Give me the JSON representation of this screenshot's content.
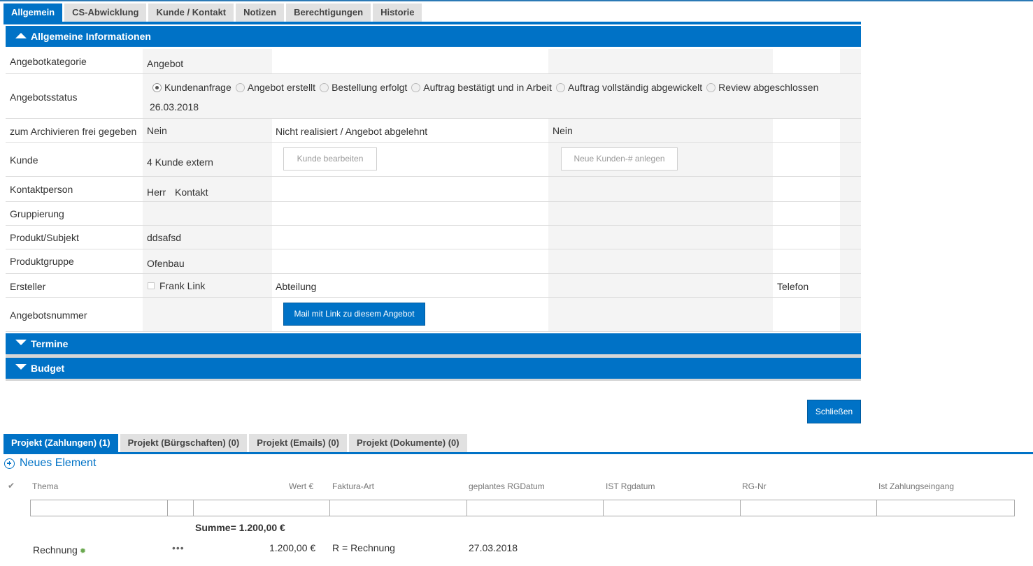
{
  "tabs": [
    "Allgemein",
    "CS-Abwicklung",
    "Kunde / Kontakt",
    "Notizen",
    "Berechtigungen",
    "Historie"
  ],
  "sections": {
    "general": "Allgemeine Informationen",
    "termine": "Termine",
    "budget": "Budget"
  },
  "form": {
    "angebotkategorie": {
      "label": "Angebotkategorie",
      "value": "Angebot"
    },
    "angebotsstatus": {
      "label": "Angebotsstatus",
      "options": [
        "Kundenanfrage",
        "Angebot erstellt",
        "Bestellung erfolgt",
        "Auftrag bestätigt und in Arbeit",
        "Auftrag vollständig abgewickelt",
        "Review abgeschlossen"
      ],
      "selected": "Kundenanfrage",
      "date": "26.03.2018"
    },
    "archiv": {
      "label": "zum Archivieren frei gegeben",
      "value": "Nein",
      "label2": "Nicht realisiert / Angebot abgelehnt",
      "value2": "Nein"
    },
    "kunde": {
      "label": "Kunde",
      "value": "4 Kunde extern",
      "edit_button": "Kunde bearbeiten",
      "new_button": "Neue Kunden-# anlegen"
    },
    "kontaktperson": {
      "label": "Kontaktperson",
      "anrede": "Herr",
      "name": "Kontakt"
    },
    "gruppierung": {
      "label": "Gruppierung"
    },
    "produkt": {
      "label": "Produkt/Subjekt",
      "value": "ddsafsd"
    },
    "produktgruppe": {
      "label": "Produktgruppe",
      "value": "Ofenbau"
    },
    "ersteller": {
      "label": "Ersteller",
      "value": "Frank Link",
      "abteilung_label": "Abteilung",
      "telefon_label": "Telefon"
    },
    "angebotsnummer": {
      "label": "Angebotsnummer",
      "mail_button": "Mail mit Link zu diesem Angebot"
    }
  },
  "close_button": "Schließen",
  "bottom_tabs": [
    "Projekt (Zahlungen) (1)",
    "Projekt (Bürgschaften) (0)",
    "Projekt (Emails) (0)",
    "Projekt (Dokumente) (0)"
  ],
  "new_element": "Neues Element",
  "list": {
    "columns": [
      "Thema",
      "Wert €",
      "Faktura-Art",
      "geplantes RGDatum",
      "IST Rgdatum",
      "RG-Nr",
      "Ist Zahlungseingang"
    ],
    "sum_label": "Summe",
    "sum_value": "= 1.200,00 €",
    "rows": [
      {
        "thema": "Rechnung",
        "wert": "1.200,00 €",
        "faktura": "R = Rechnung",
        "geplant": "27.03.2018"
      }
    ]
  },
  "colors": {
    "accent": "#0072c6",
    "tab_inactive": "#e1e1e1",
    "cell_shade": "#f4f4f4"
  },
  "icons": [
    "chevron-up-icon",
    "chevron-down-icon",
    "radio-icon",
    "checkbox-icon",
    "plus-circle-icon",
    "check-icon",
    "gear-icon",
    "ellipsis-icon"
  ]
}
